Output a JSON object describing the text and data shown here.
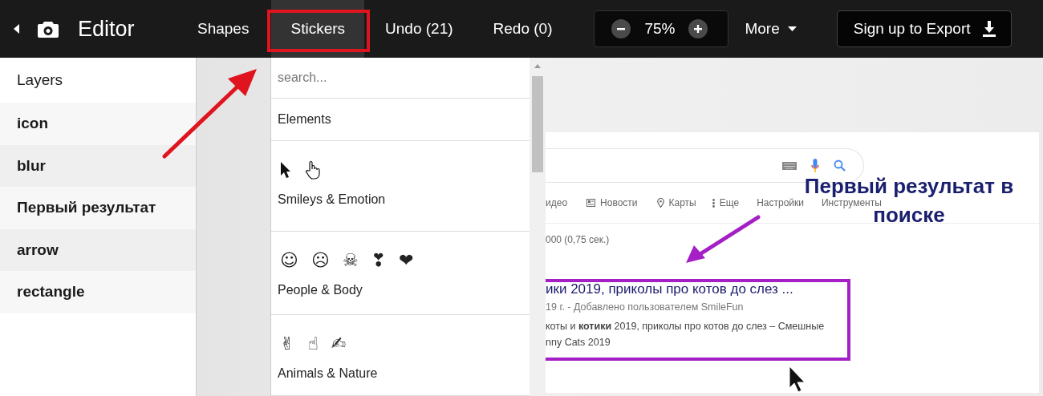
{
  "toolbar": {
    "title": "Editor",
    "tabs": [
      {
        "label": "Shapes",
        "selected": false
      },
      {
        "label": "Stickers",
        "selected": true
      },
      {
        "label": "Undo (21)",
        "selected": false
      },
      {
        "label": "Redo (0)",
        "selected": false
      }
    ],
    "zoom": "75%",
    "more": "More",
    "export": "Sign up to Export"
  },
  "layers": {
    "title": "Layers",
    "items": [
      "icon",
      "blur",
      "Первый результат",
      "arrow",
      "rectangle"
    ]
  },
  "stickers": {
    "search": {
      "placeholder": "search..."
    },
    "categories": [
      {
        "label": "Elements"
      },
      {
        "label": "Smileys & Emotion",
        "stickers": [
          {
            "kind": "cursor"
          },
          {
            "kind": "hand"
          }
        ]
      },
      {
        "label": "People & Body",
        "stickers": [
          {
            "kind": "glyph",
            "text": "☺"
          },
          {
            "kind": "glyph",
            "text": "☹"
          },
          {
            "kind": "glyph",
            "text": "☠"
          },
          {
            "kind": "glyph",
            "text": "❣"
          },
          {
            "kind": "glyph",
            "text": "❤"
          }
        ]
      },
      {
        "label": "Animals & Nature",
        "stickers": [
          {
            "kind": "glyph",
            "text": "✌"
          },
          {
            "kind": "glyph",
            "text": "☝"
          },
          {
            "kind": "glyph",
            "text": "✍"
          }
        ]
      }
    ]
  },
  "canvas": {
    "tabs": [
      "идео",
      "Новости",
      "Карты",
      "Еще",
      "Настройки",
      "Инструменты"
    ],
    "stats": "000 (0,75 сек.)",
    "result": {
      "title": "ики 2019, приколы про котов до слез ...",
      "meta": "19 г. - Добавлено пользователем SmileFun",
      "snippet": "коты и **котики** 2019, приколы про котов до слез – Смешные",
      "snippet_2": "nny Cats 2019"
    },
    "annotation": [
      "Первый результат в",
      "поиске"
    ]
  }
}
